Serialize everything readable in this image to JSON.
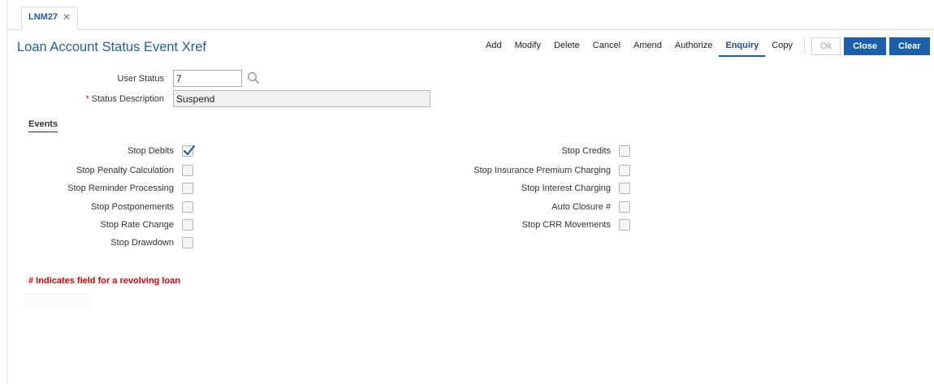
{
  "tab": {
    "label": "LNM27",
    "close_glyph": "✕"
  },
  "page": {
    "title": "Loan Account Status Event Xref"
  },
  "toolbar": {
    "actions": [
      "Add",
      "Modify",
      "Delete",
      "Cancel",
      "Amend",
      "Authorize",
      "Enquiry",
      "Copy"
    ],
    "active": "Enquiry",
    "ok_label": "Ok",
    "close_label": "Close",
    "clear_label": "Clear"
  },
  "form": {
    "user_status": {
      "label": "User Status",
      "value": "7"
    },
    "status_description": {
      "label": "Status Description",
      "required_mark": "*",
      "value": "Suspend"
    }
  },
  "events": {
    "heading": "Events",
    "left": [
      {
        "label": "Stop Debits",
        "checked": true
      },
      {
        "label": "Stop Penalty Calculation",
        "checked": false
      },
      {
        "label": "Stop Reminder Processing",
        "checked": false
      },
      {
        "label": "Stop Postponements",
        "checked": false
      },
      {
        "label": "Stop Rate Change",
        "checked": false
      },
      {
        "label": "Stop Drawdown",
        "checked": false
      }
    ],
    "right": [
      {
        "label": "Stop Credits",
        "checked": false
      },
      {
        "label": "Stop Insurance Premium Charging",
        "checked": false
      },
      {
        "label": "Stop Interest Charging",
        "checked": false
      },
      {
        "label": "Auto Closure #",
        "checked": false
      },
      {
        "label": "Stop CRR Movements",
        "checked": false
      }
    ]
  },
  "note": "# Indicates field for a revolving loan",
  "colors": {
    "accent": "#1b5fac",
    "title": "#1f5fa4",
    "required": "#e00000",
    "check": "#1f5fa4"
  },
  "icons": {
    "search": "search-icon",
    "checkmark": "check-icon",
    "close": "close-icon"
  }
}
